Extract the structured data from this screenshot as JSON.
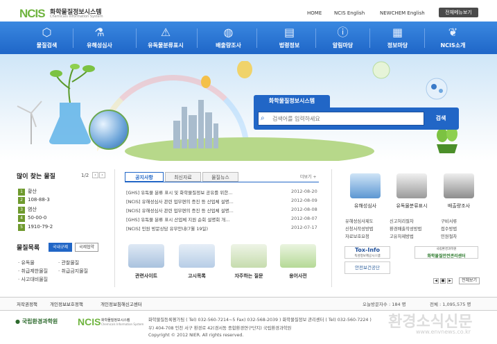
{
  "header": {
    "logo_mark": "NCIS",
    "logo_kr": "화학물질정보시스템",
    "logo_en": "Chemicals Information System",
    "links": [
      "HOME",
      "NCIS English",
      "NEWCHEM English"
    ],
    "all_menu": "전체메뉴보기"
  },
  "gnb": [
    {
      "label": "물질검색",
      "icon": "molecule-icon"
    },
    {
      "label": "유해성심사",
      "icon": "flask-icon"
    },
    {
      "label": "유독물분류표시",
      "icon": "warning-icon"
    },
    {
      "label": "배출량조사",
      "icon": "globe-icon"
    },
    {
      "label": "법령정보",
      "icon": "book-icon"
    },
    {
      "label": "알림마당",
      "icon": "alert-icon"
    },
    {
      "label": "정보마당",
      "icon": "board-icon"
    },
    {
      "label": "NCIS소개",
      "icon": "leaf-icon"
    }
  ],
  "search": {
    "title": "화학물질정보시스템",
    "placeholder": "검색어를 입력하세요",
    "button": "검색"
  },
  "popular": {
    "title": "많이 찾는 물질",
    "page": "1/2",
    "items": [
      {
        "rank": "1",
        "name": "황산"
      },
      {
        "rank": "2",
        "name": "108-88-3"
      },
      {
        "rank": "3",
        "name": "염산"
      },
      {
        "rank": "4",
        "name": "50-00-0"
      },
      {
        "rank": "5",
        "name": "1910-79-2"
      }
    ]
  },
  "substance_list": {
    "title": "물질목록",
    "tabs": [
      "국내규제",
      "국제협약"
    ],
    "items": [
      "유독물",
      "관찰물질",
      "취급제한물질",
      "취급금지물질",
      "사고대비물질"
    ]
  },
  "notice": {
    "tabs": [
      "공지사항",
      "최신자료",
      "물질뉴스"
    ],
    "more": "더보기 +",
    "rows": [
      {
        "title": "[GHS] 유독물 분류 표시 및 화학물질정보 공유를 위한...",
        "date": "2012-08-20"
      },
      {
        "title": "[NCIS] 유해성심사 관련 업무편의 증진 등 산업체 설명...",
        "date": "2012-08-09"
      },
      {
        "title": "[NCIS] 유해성심사 관련 업무편의 증진 등 산업체 설명...",
        "date": "2012-08-08"
      },
      {
        "title": "[GHS] 유독물 분류 표시 산업체 지원 순회 설명회 개...",
        "date": "2012-08-07"
      },
      {
        "title": "[NCIS] 민원 방문상담 유무안내(7월 19일)",
        "date": "2012-07-17"
      }
    ]
  },
  "quick": [
    "관련사이트",
    "고시목록",
    "자주하는 질문",
    "용어사전"
  ],
  "services": {
    "items": [
      "유해성심사",
      "유독물분류표시",
      "배출량조사"
    ],
    "links": [
      [
        "유해성심사제도",
        "신고처리절차",
        "구비서류"
      ],
      [
        "신청서작성방법",
        "환경배출작성방법",
        "접수방법"
      ],
      [
        "자료보호요청",
        "고유자제방법",
        "민원절차"
      ]
    ],
    "banners": [
      "Tox-Info",
      "독성정보제공시스템",
      "국립환경과학원",
      "화학물질안전관리센터",
      "안전보건공단"
    ],
    "view_all": "전체보기"
  },
  "footer": {
    "links": [
      "저작권정책",
      "개인정보보호정책",
      "개인정보침해신고센터"
    ],
    "today_label": "오늘방문자수 : 184 명",
    "total_label": "전체 : 1,095,575 명",
    "org": "국립환경과학원",
    "ncis": "NCIS",
    "ncis_kr": "화학물질정보시스템",
    "ncis_en": "Chemicals Information System",
    "address_lines": [
      "화학물질등록평가팀 ( Tel) 032-560-7214~5 Fax) 032-568-2039 ) 화학물질정보 관리센터 ( Tel) 032-560-7224 )",
      "우) 404-708 인천 서구 환경로 42(경서동 종합환경연구단지) 국립환경과학원",
      "Copyright © 2012 NIER. All rights reserved."
    ],
    "watermark": "환경소식신문",
    "watermark_url": "www.envnews.co.kr"
  }
}
